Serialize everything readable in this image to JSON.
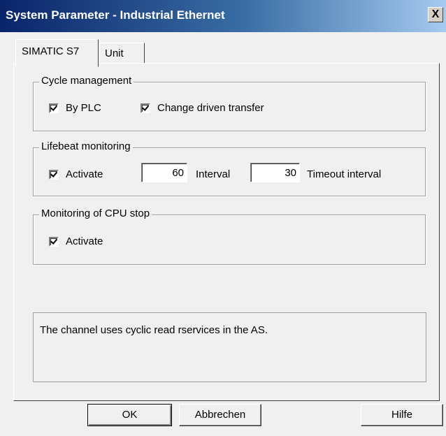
{
  "window": {
    "title": "System Parameter - Industrial Ethernet",
    "close_label": "X"
  },
  "tabs": [
    {
      "label": "SIMATIC S7",
      "active": true
    },
    {
      "label": "Unit",
      "active": false
    }
  ],
  "cycle_management": {
    "title": "Cycle management",
    "by_plc": {
      "label": "By PLC",
      "checked": true
    },
    "change_driven": {
      "label": "Change driven transfer",
      "checked": true
    }
  },
  "lifebeat_monitoring": {
    "title": "Lifebeat monitoring",
    "activate": {
      "label": "Activate",
      "checked": true
    },
    "interval_value": "60",
    "interval_label": "Interval",
    "timeout_value": "30",
    "timeout_label": "Timeout interval"
  },
  "cpu_stop_monitoring": {
    "title": "Monitoring of CPU stop",
    "activate": {
      "label": "Activate",
      "checked": true
    }
  },
  "info": {
    "text": "The channel uses cyclic read rservices in the AS."
  },
  "buttons": {
    "ok": "OK",
    "cancel": "Abbrechen",
    "help": "Hilfe"
  },
  "colors": {
    "titlebar_start": "#0a246a",
    "titlebar_end": "#a6caf0",
    "dialog_background": "#f0f0f0"
  }
}
